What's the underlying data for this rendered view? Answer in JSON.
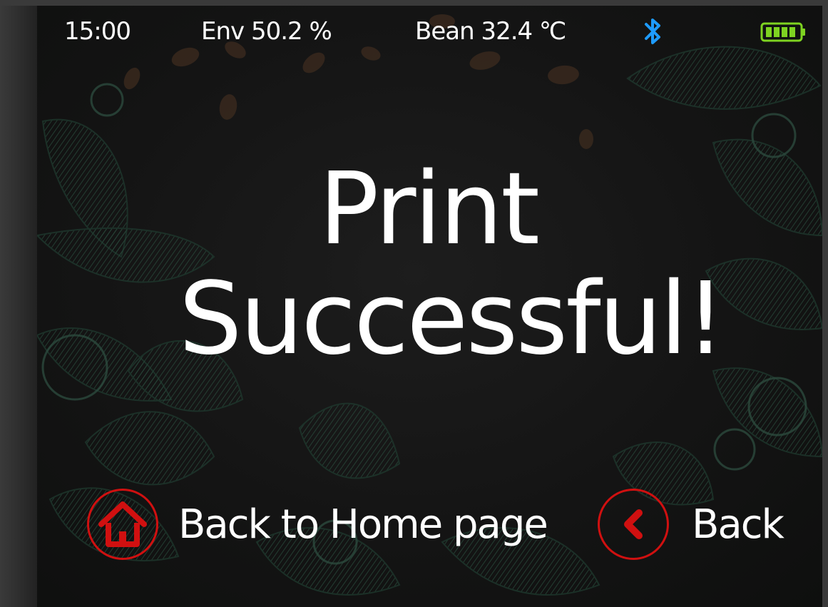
{
  "status": {
    "time": "15:00",
    "env": "Env 50.2  %",
    "bean": "Bean 32.4  ℃",
    "bluetooth_icon": "bluetooth-icon",
    "battery_icon": "battery-full-icon",
    "bluetooth_color": "#1e9bff",
    "battery_color": "#7ed321"
  },
  "message": {
    "line1": "Print",
    "line2": "Successful!"
  },
  "actions": {
    "home_label": "Back to Home page",
    "home_icon": "home-icon",
    "back_label": "Back",
    "back_icon": "chevron-left-icon",
    "accent": "#d01010"
  }
}
